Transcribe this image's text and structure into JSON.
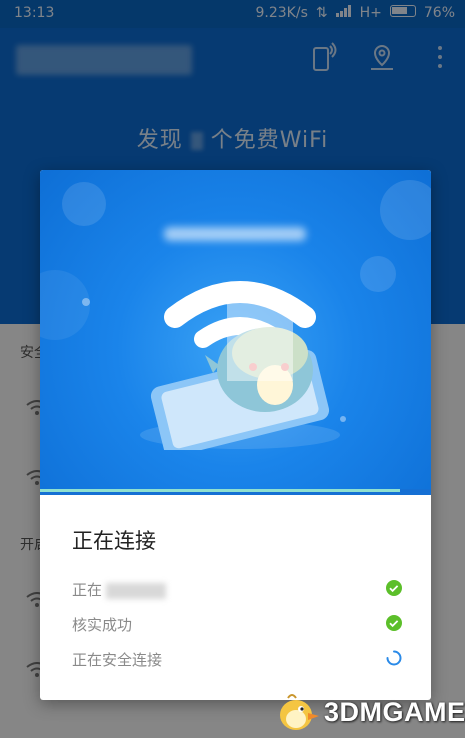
{
  "status_bar": {
    "time": "13:13",
    "network_speed": "9.23K/s",
    "network_type": "H+",
    "battery": "76%"
  },
  "header": {
    "title_prefix": "发现",
    "title_suffix": "个免费WiFi",
    "icons": [
      "phone-wifi-icon",
      "map-pin-icon",
      "more-icon"
    ]
  },
  "background_list": {
    "section_1": "安全",
    "section_2": "开启"
  },
  "dialog": {
    "progress": 0.92,
    "title": "正在连接",
    "steps": [
      {
        "label": "正在",
        "state": "done"
      },
      {
        "label": "核实成功",
        "state": "done"
      },
      {
        "label": "正在安全连接",
        "state": "loading"
      }
    ]
  },
  "watermark": {
    "text": "3DMGAME"
  },
  "colors": {
    "brand_blue": "#0c6ad0",
    "success_green": "#5cbf2a",
    "loading_blue": "#2a8ae8"
  }
}
